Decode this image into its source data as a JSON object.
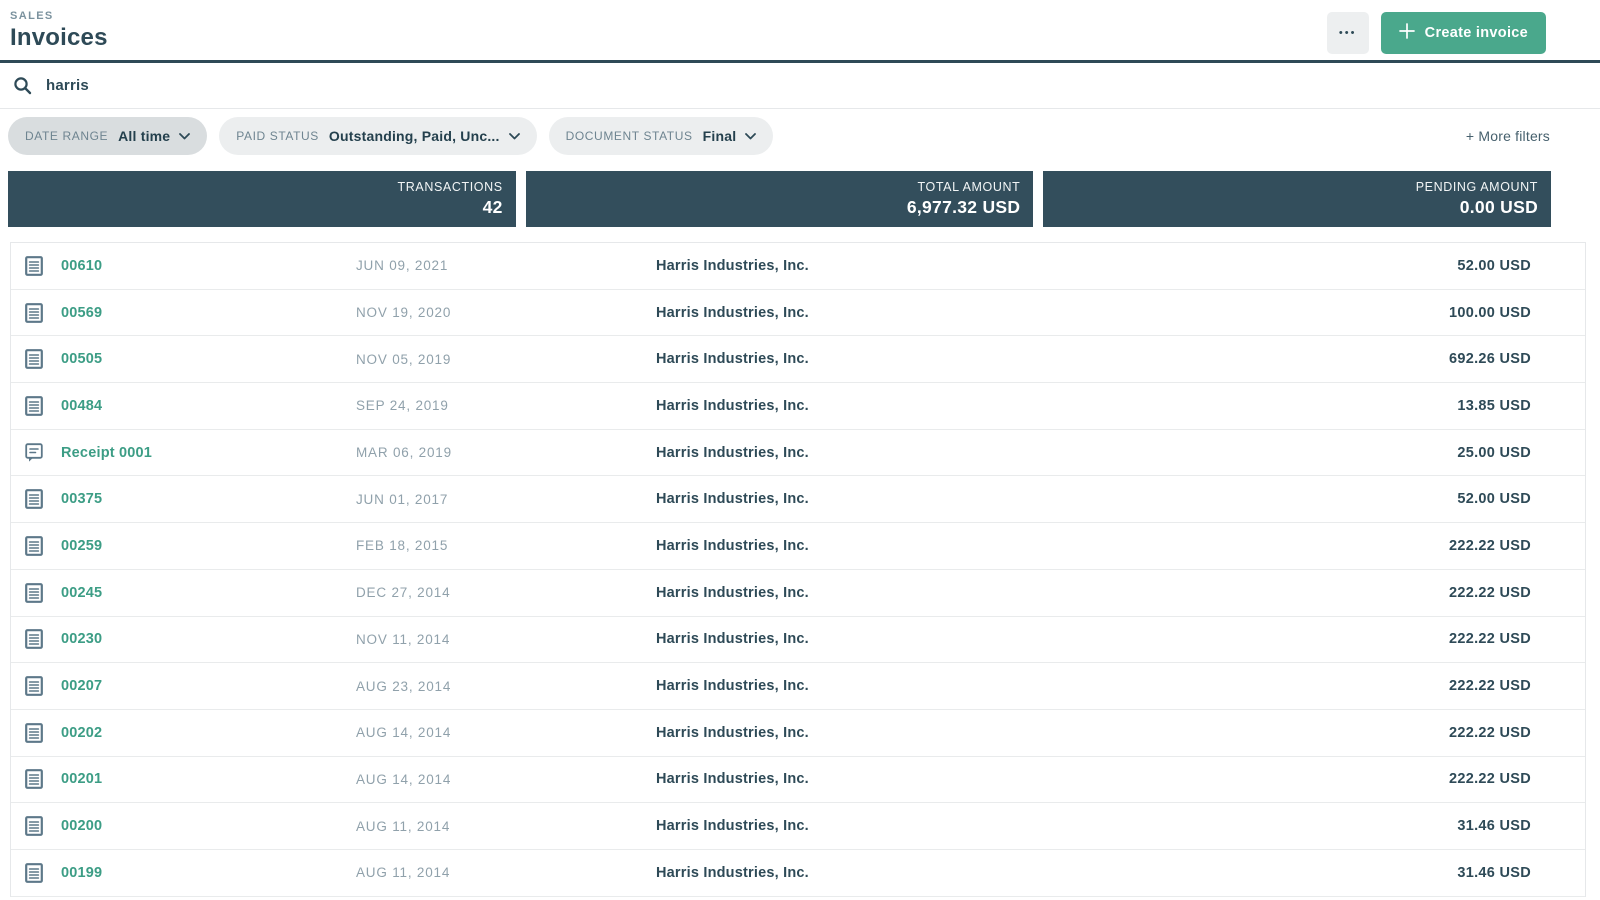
{
  "header": {
    "eyebrow": "SALES",
    "title": "Invoices",
    "actions": {
      "more_label": "•••",
      "create_label": "Create invoice"
    }
  },
  "search": {
    "value": "harris"
  },
  "filters": {
    "chips": [
      {
        "label": "DATE RANGE",
        "value": "All time"
      },
      {
        "label": "PAID STATUS",
        "value": "Outstanding, Paid, Unc..."
      },
      {
        "label": "DOCUMENT STATUS",
        "value": "Final"
      }
    ],
    "more_filters_label": "+ More filters"
  },
  "stats": [
    {
      "label": "TRANSACTIONS",
      "value": "42"
    },
    {
      "label": "TOTAL AMOUNT",
      "value": "6,977.32 USD"
    },
    {
      "label": "PENDING AMOUNT",
      "value": "0.00 USD"
    }
  ],
  "table": {
    "rows": [
      {
        "icon": "invoice-icon",
        "number": "00610",
        "date": "JUN 09, 2021",
        "customer": "Harris Industries, Inc.",
        "amount": "52.00 USD"
      },
      {
        "icon": "invoice-icon",
        "number": "00569",
        "date": "NOV 19, 2020",
        "customer": "Harris Industries, Inc.",
        "amount": "100.00 USD"
      },
      {
        "icon": "invoice-icon",
        "number": "00505",
        "date": "NOV 05, 2019",
        "customer": "Harris Industries, Inc.",
        "amount": "692.26 USD"
      },
      {
        "icon": "invoice-icon",
        "number": "00484",
        "date": "SEP 24, 2019",
        "customer": "Harris Industries, Inc.",
        "amount": "13.85 USD"
      },
      {
        "icon": "receipt-icon",
        "number": "Receipt 0001",
        "date": "MAR 06, 2019",
        "customer": "Harris Industries, Inc.",
        "amount": "25.00 USD"
      },
      {
        "icon": "invoice-icon",
        "number": "00375",
        "date": "JUN 01, 2017",
        "customer": "Harris Industries, Inc.",
        "amount": "52.00 USD"
      },
      {
        "icon": "invoice-icon",
        "number": "00259",
        "date": "FEB 18, 2015",
        "customer": "Harris Industries, Inc.",
        "amount": "222.22 USD"
      },
      {
        "icon": "invoice-icon",
        "number": "00245",
        "date": "DEC 27, 2014",
        "customer": "Harris Industries, Inc.",
        "amount": "222.22 USD"
      },
      {
        "icon": "invoice-icon",
        "number": "00230",
        "date": "NOV 11, 2014",
        "customer": "Harris Industries, Inc.",
        "amount": "222.22 USD"
      },
      {
        "icon": "invoice-icon",
        "number": "00207",
        "date": "AUG 23, 2014",
        "customer": "Harris Industries, Inc.",
        "amount": "222.22 USD"
      },
      {
        "icon": "invoice-icon",
        "number": "00202",
        "date": "AUG 14, 2014",
        "customer": "Harris Industries, Inc.",
        "amount": "222.22 USD"
      },
      {
        "icon": "invoice-icon",
        "number": "00201",
        "date": "AUG 14, 2014",
        "customer": "Harris Industries, Inc.",
        "amount": "222.22 USD"
      },
      {
        "icon": "invoice-icon",
        "number": "00200",
        "date": "AUG 11, 2014",
        "customer": "Harris Industries, Inc.",
        "amount": "31.46 USD"
      },
      {
        "icon": "invoice-icon",
        "number": "00199",
        "date": "AUG 11, 2014",
        "customer": "Harris Industries, Inc.",
        "amount": "31.46 USD"
      }
    ]
  },
  "colors": {
    "brand_dark": "#2E4A57",
    "stat_bg": "#334E5C",
    "accent_green": "#4AA88C",
    "link_teal": "#3C9D85",
    "icon_gray": "#5D7889"
  }
}
